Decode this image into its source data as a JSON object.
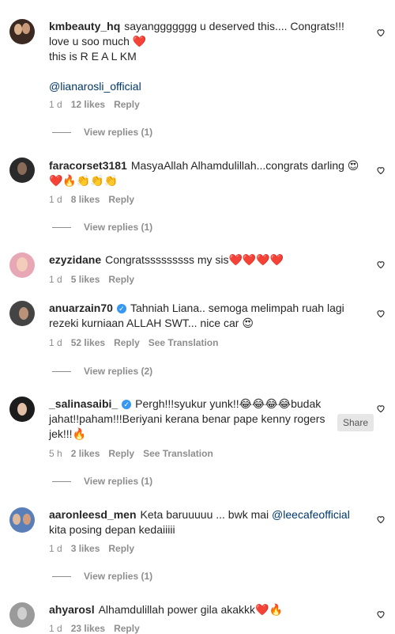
{
  "comments": [
    {
      "username": "kmbeauty_hq",
      "text": "sayanggggggg u deserved this.... Congrats!!! love u soo much ❤️",
      "line2": "this is R E A L KM",
      "mention": "@lianarosli_official",
      "time": "1 d",
      "likes": "12 likes",
      "reply": "Reply",
      "view_replies": "View replies (1)"
    },
    {
      "username": "faracorset3181",
      "text": "MasyaAllah Alhamdulillah...congrats darling 😍❤️🔥👏👏👏",
      "time": "1 d",
      "likes": "8 likes",
      "reply": "Reply",
      "view_replies": "View replies (1)"
    },
    {
      "username": "ezyzidane",
      "text": "Congratsssssssss my sis❤️❤️❤️❤️",
      "time": "1 d",
      "likes": "5 likes",
      "reply": "Reply"
    },
    {
      "username": "anuarzain70",
      "verified": true,
      "text": "Tahniah Liana.. semoga melimpah ruah lagi rezeki kurniaan ALLAH SWT... nice car 😍",
      "time": "1 d",
      "likes": "52 likes",
      "reply": "Reply",
      "translation": "See Translation",
      "view_replies": "View replies (2)"
    },
    {
      "username": "_salinasaibi_",
      "verified": true,
      "text": "Pergh!!!syukur yunk!!😂😂😂😂budak jahat!!paham!!!Beriyani kerana benar pape kenny rogers jek!!!🔥",
      "time": "5 h",
      "likes": "2 likes",
      "reply": "Reply",
      "translation": "See Translation",
      "view_replies": "View replies (1)"
    },
    {
      "username": "aaronleesd_men",
      "text_before": "Keta baruuuuu ... bwk mai ",
      "mention": "@leecafeofficial",
      "text_after": " kita posing depan kedaiiiii",
      "time": "1 d",
      "likes": "3 likes",
      "reply": "Reply",
      "view_replies": "View replies (1)"
    },
    {
      "username": "ahyarosl",
      "text": "Alhamdulillah power gila akakkk❤️🔥",
      "time": "1 d",
      "likes": "23 likes",
      "reply": "Reply"
    }
  ],
  "tooltip": {
    "share": "Share"
  },
  "colors": {
    "verified": "#3897f0",
    "mention": "#00376b",
    "meta": "#8e8e8e"
  }
}
